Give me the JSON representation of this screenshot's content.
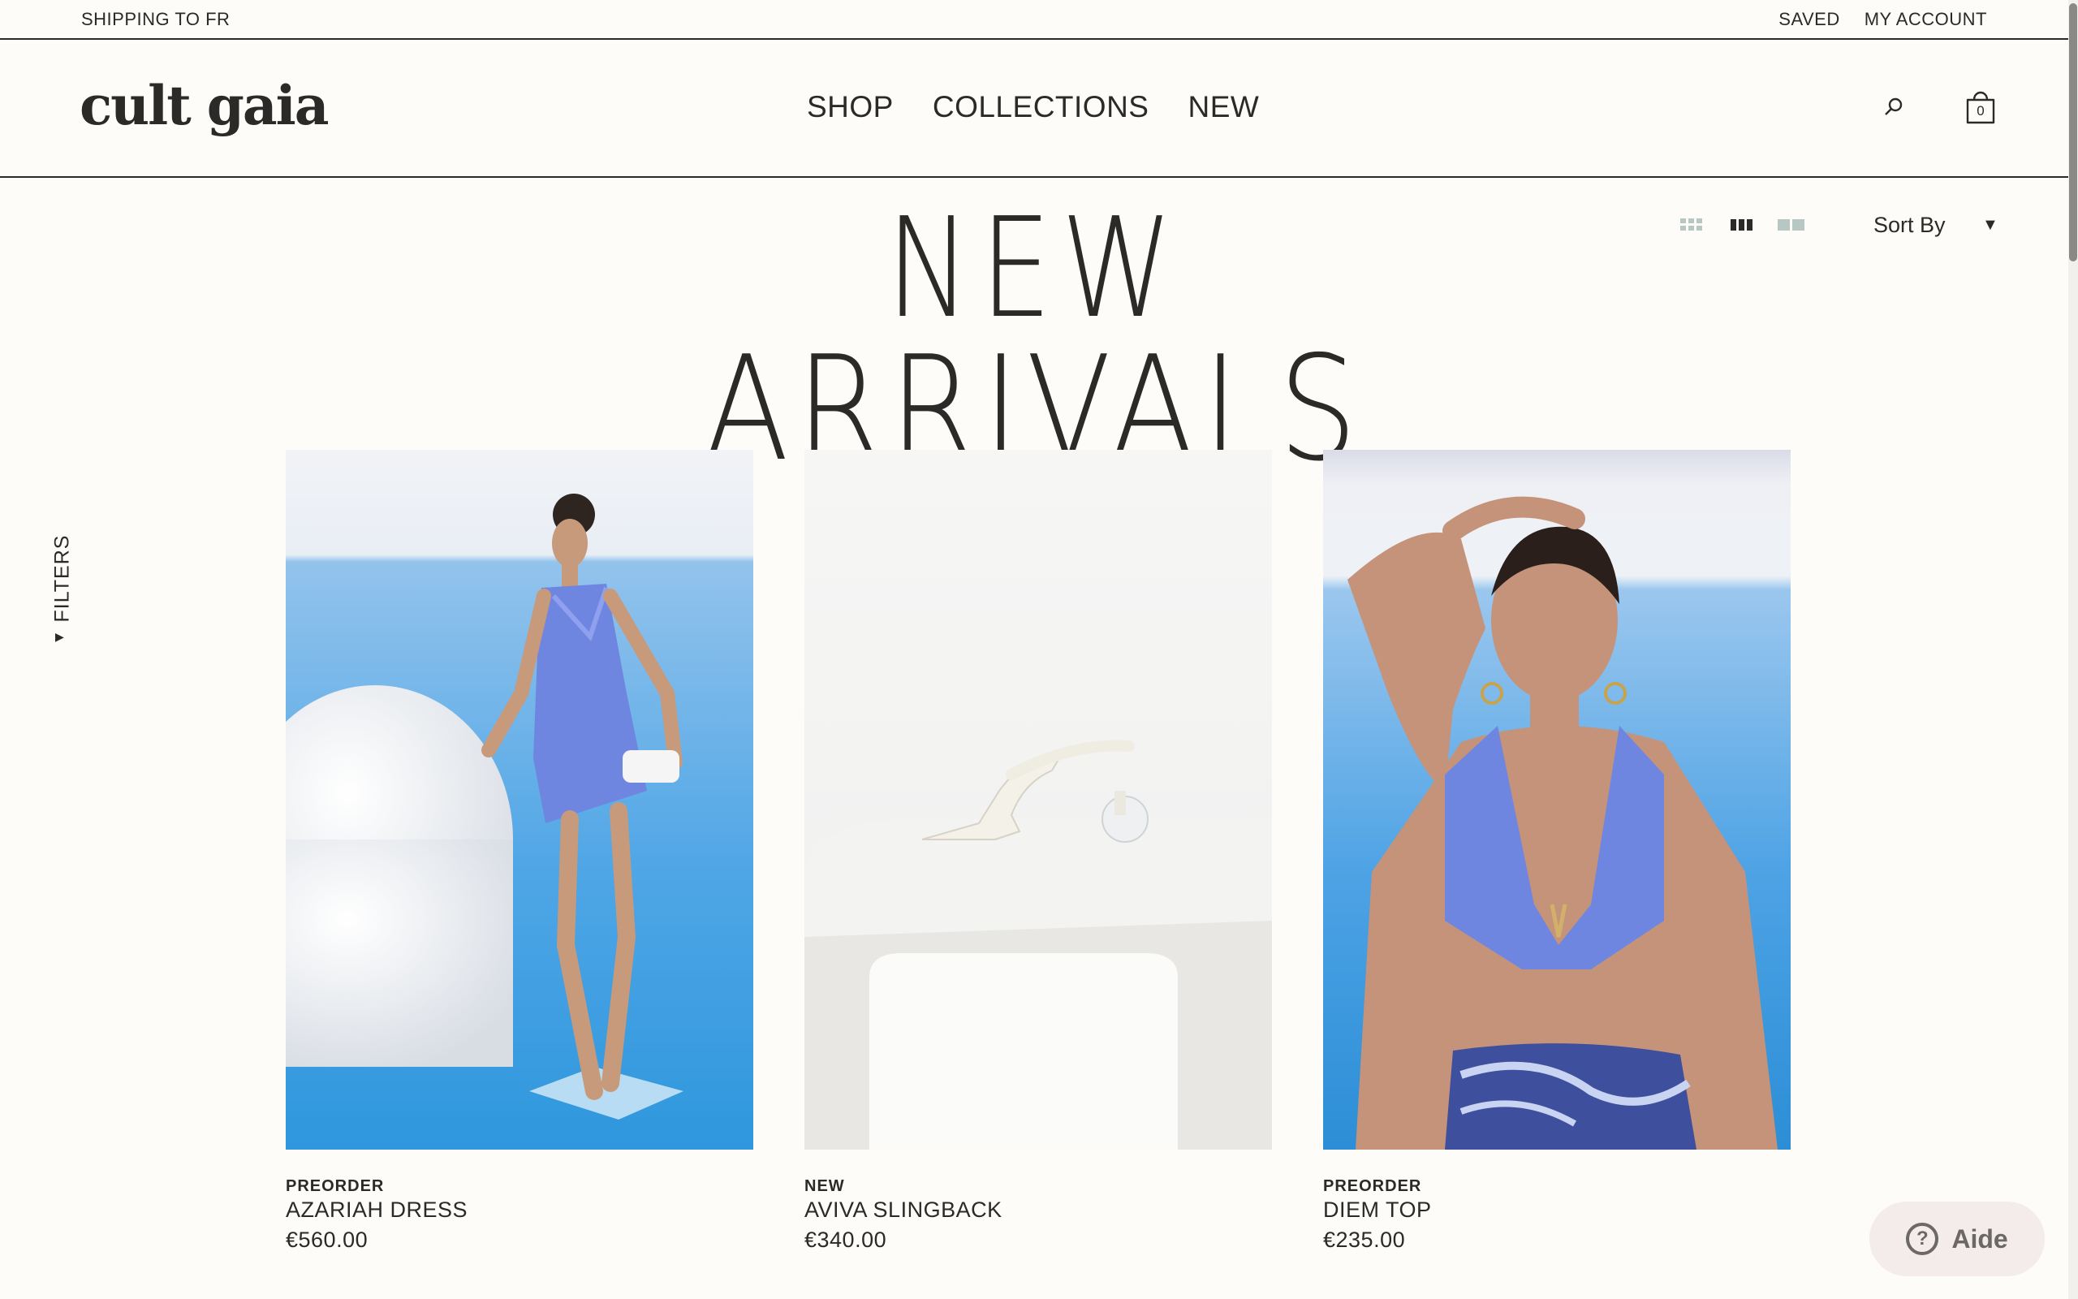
{
  "topbar": {
    "shipping": "SHIPPING TO FR",
    "saved": "SAVED",
    "account": "MY ACCOUNT"
  },
  "header": {
    "logo": "cult gaia",
    "nav": [
      "SHOP",
      "COLLECTIONS",
      "NEW"
    ],
    "search_icon": "search-icon",
    "bag_icon": "shopping-bag-icon",
    "bag_count": "0"
  },
  "toolbar": {
    "view_options": [
      "grid-4-icon",
      "grid-3-icon",
      "grid-2-icon"
    ],
    "active_view": "grid-3-icon",
    "sort_label": "Sort By"
  },
  "page": {
    "title_line_1": "NEW",
    "title_line_2": "ARRIVALS"
  },
  "filters": {
    "label": "FILTERS"
  },
  "products": [
    {
      "badge": "PREORDER",
      "name": "AZARIAH DRESS",
      "price": "€560.00"
    },
    {
      "badge": "NEW",
      "name": "AVIVA SLINGBACK",
      "price": "€340.00"
    },
    {
      "badge": "PREORDER",
      "name": "DIEM TOP",
      "price": "€235.00"
    }
  ],
  "help": {
    "label": "Aide",
    "icon": "question-icon"
  },
  "colors": {
    "background": "#fdfcf9",
    "text": "#2b2a28",
    "product_blue": "#6f86e0",
    "pool_blue": "#3a9be0"
  }
}
